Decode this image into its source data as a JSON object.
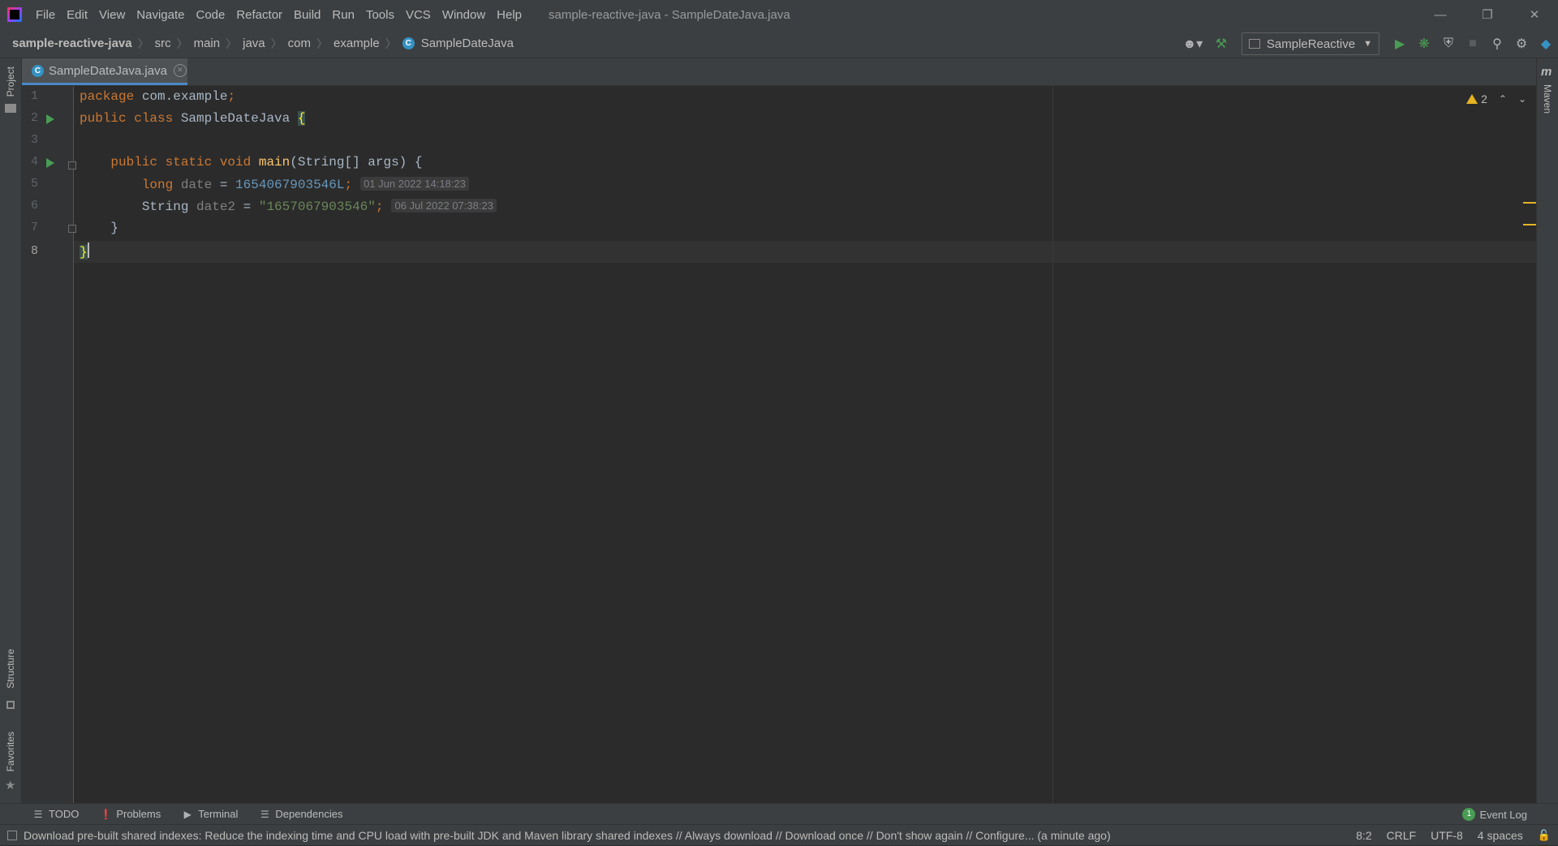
{
  "window": {
    "title": "sample-reactive-java - SampleDateJava.java",
    "menu": [
      "File",
      "Edit",
      "View",
      "Navigate",
      "Code",
      "Refactor",
      "Build",
      "Run",
      "Tools",
      "VCS",
      "Window",
      "Help"
    ]
  },
  "breadcrumbs": {
    "project": "sample-reactive-java",
    "path": [
      "src",
      "main",
      "java",
      "com",
      "example"
    ],
    "file": "SampleDateJava"
  },
  "run_config": {
    "selected": "SampleReactive"
  },
  "side_tabs": {
    "project": "Project",
    "structure": "Structure",
    "favorites": "Favorites",
    "maven": "Maven"
  },
  "editor_tab": {
    "label": "SampleDateJava.java"
  },
  "inspections": {
    "warning_count": "2"
  },
  "code": {
    "line_numbers": [
      "1",
      "2",
      "3",
      "4",
      "5",
      "6",
      "7",
      "8"
    ],
    "current_line": 8,
    "l1_kw": "package",
    "l1_pkg": " com.example",
    "l1_semi": ";",
    "l2_kw": "public class",
    "l2_name": " SampleDateJava ",
    "l2_brace": "{",
    "l4_indent": "    ",
    "l4_kw": "public static void",
    "l4_sp": " ",
    "l4_fn": "main",
    "l4_rest": "(String[] args) {",
    "l5_indent": "        ",
    "l5_kw": "long",
    "l5_var": " date",
    "l5_eq": " = ",
    "l5_num": "1654067903546L",
    "l5_semi": ";",
    "l5_hint": "01 Jun 2022 14:18:23",
    "l6_indent": "        ",
    "l6_type": "String",
    "l6_var": " date2",
    "l6_eq": " = ",
    "l6_str": "\"1657067903546\"",
    "l6_semi": ";",
    "l6_hint": "06 Jul 2022 07:38:23",
    "l7": "    }",
    "l8": "}"
  },
  "bottom_tools": [
    "TODO",
    "Problems",
    "Terminal",
    "Dependencies"
  ],
  "event_log": {
    "count": "1",
    "label": "Event Log"
  },
  "status": {
    "message": "Download pre-built shared indexes: Reduce the indexing time and CPU load with pre-built JDK and Maven library shared indexes // Always download // Download once // Don't show again // Configure... (a minute ago)",
    "position": "8:2",
    "line_sep": "CRLF",
    "encoding": "UTF-8",
    "indent": "4 spaces"
  },
  "colors": {
    "keyword": "#cc7832",
    "function": "#ffc66d",
    "number": "#6897bb",
    "string": "#6a8759",
    "background": "#2b2b2b",
    "chrome": "#3c3f41",
    "accent": "#4a88c7",
    "run_green": "#499c54",
    "warning": "#e6b422"
  }
}
